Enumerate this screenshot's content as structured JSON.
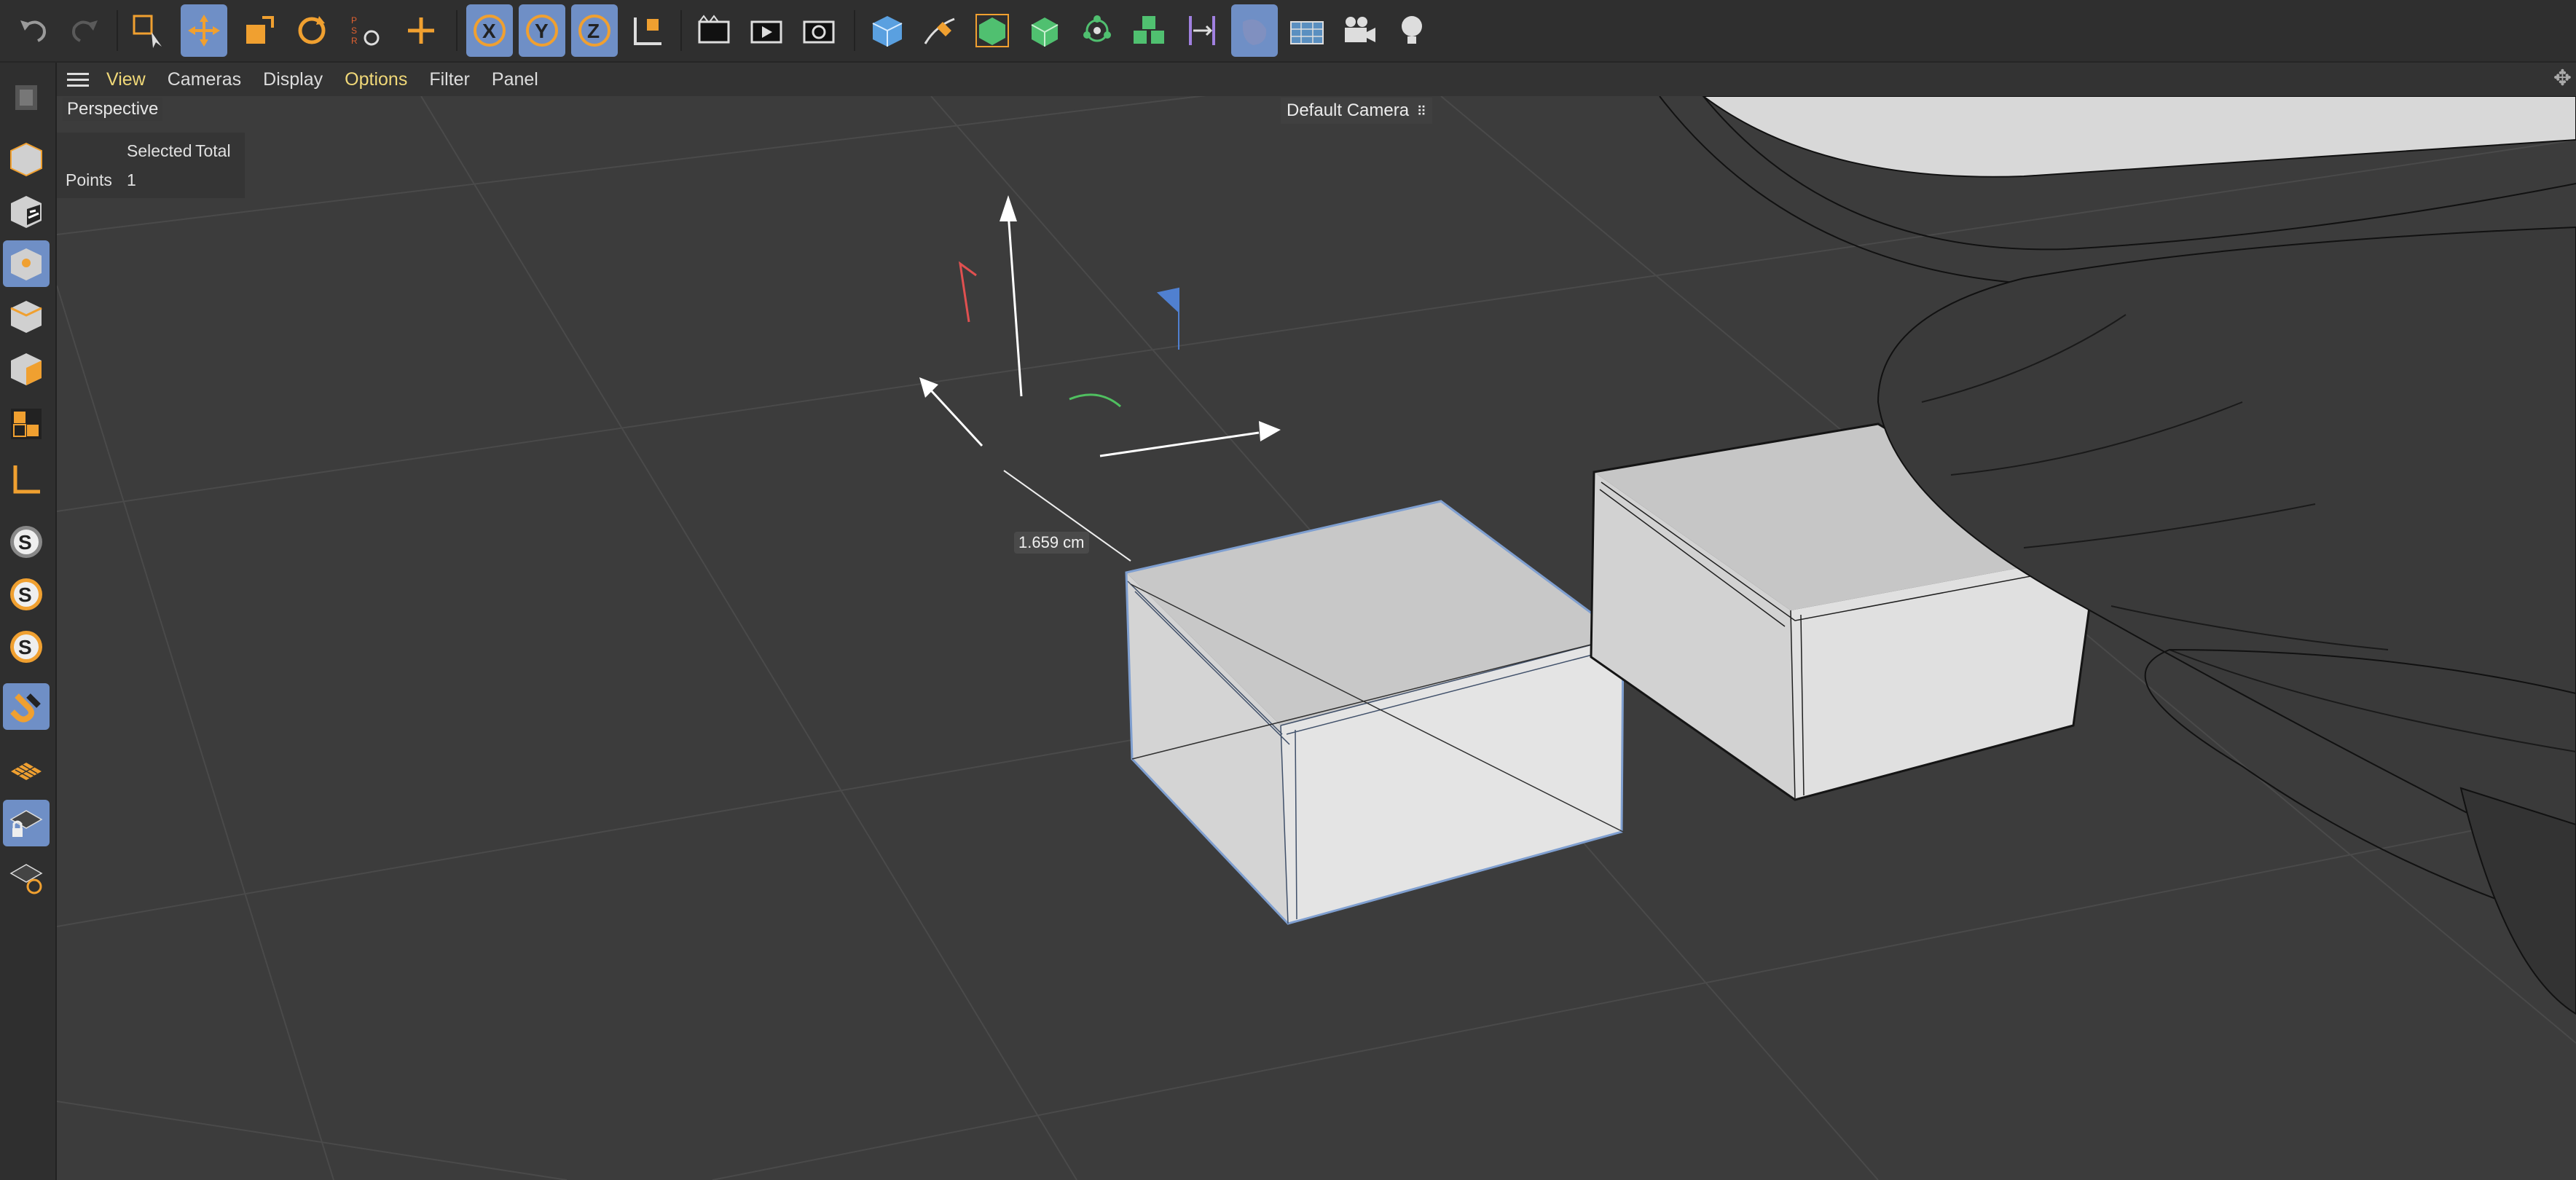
{
  "toolbar": {
    "buttons": [
      {
        "name": "undo-icon",
        "active": false
      },
      {
        "name": "redo-icon",
        "active": false
      },
      {
        "name": "live-selection-icon",
        "active": false
      },
      {
        "name": "move-tool-icon",
        "active": true
      },
      {
        "name": "scale-tool-icon",
        "active": false
      },
      {
        "name": "rotate-tool-icon",
        "active": false
      },
      {
        "name": "psr-recent-tool-icon",
        "active": false
      },
      {
        "name": "create-cross-icon",
        "active": false
      },
      {
        "name": "x-axis-lock-icon",
        "active": true
      },
      {
        "name": "y-axis-lock-icon",
        "active": true
      },
      {
        "name": "z-axis-lock-icon",
        "active": true
      },
      {
        "name": "coordinate-system-icon",
        "active": false
      },
      {
        "name": "render-view-icon",
        "active": false
      },
      {
        "name": "render-to-picture-viewer-icon",
        "active": false
      },
      {
        "name": "render-settings-icon",
        "active": false
      },
      {
        "name": "cube-primitive-icon",
        "active": false
      },
      {
        "name": "pen-spline-icon",
        "active": false
      },
      {
        "name": "subdivision-surface-icon",
        "active": false
      },
      {
        "name": "extrude-generator-icon",
        "active": false
      },
      {
        "name": "cloner-icon",
        "active": false
      },
      {
        "name": "fracture-icon",
        "active": false
      },
      {
        "name": "bend-deformer-icon",
        "active": false
      },
      {
        "name": "environment-icon",
        "active": true
      },
      {
        "name": "floor-icon",
        "active": false
      },
      {
        "name": "camera-icon",
        "active": false
      },
      {
        "name": "light-icon",
        "active": false
      }
    ],
    "psr_label": "PSR",
    "x_label": "X",
    "y_label": "Y",
    "z_label": "Z"
  },
  "leftbar": {
    "buttons": [
      {
        "name": "make-editable-icon",
        "active": false
      },
      {
        "name": "model-mode-icon",
        "active": false
      },
      {
        "name": "texture-mode-icon",
        "active": false
      },
      {
        "name": "points-mode-icon",
        "active": true
      },
      {
        "name": "edges-mode-icon",
        "active": false
      },
      {
        "name": "polygons-mode-icon",
        "active": false
      },
      {
        "name": "uv-mode-icon",
        "active": false
      },
      {
        "name": "axis-mode-icon",
        "active": false
      },
      {
        "name": "solo-off-icon",
        "active": false
      },
      {
        "name": "solo-single-icon",
        "active": false
      },
      {
        "name": "solo-hierarchy-icon",
        "active": false
      },
      {
        "name": "snapping-icon",
        "active": true
      },
      {
        "name": "workplane-icon",
        "active": false
      },
      {
        "name": "locked-workplane-icon",
        "active": true
      },
      {
        "name": "workplane-align-icon",
        "active": false
      }
    ],
    "solo_letter": "S"
  },
  "menubar": {
    "items": [
      "View",
      "Cameras",
      "Display",
      "Options",
      "Filter",
      "Panel"
    ],
    "active_item": "Options"
  },
  "viewport": {
    "name": "Perspective",
    "camera": "Default Camera",
    "hud": {
      "col_selected": "Selected",
      "col_total": "Total",
      "row_label": "Points",
      "row_selected": "1",
      "row_total": ""
    },
    "measure": "1.659 cm"
  },
  "colors": {
    "toolbar_bg": "#2f2f2f",
    "viewport_bg": "#3c3c3c",
    "active_button": "#6f8fc6",
    "accent_orange": "#f0a030",
    "menu_active": "#f0d878",
    "x_axis": "#e05050",
    "y_axis": "#50c060",
    "z_axis": "#5080d0"
  }
}
